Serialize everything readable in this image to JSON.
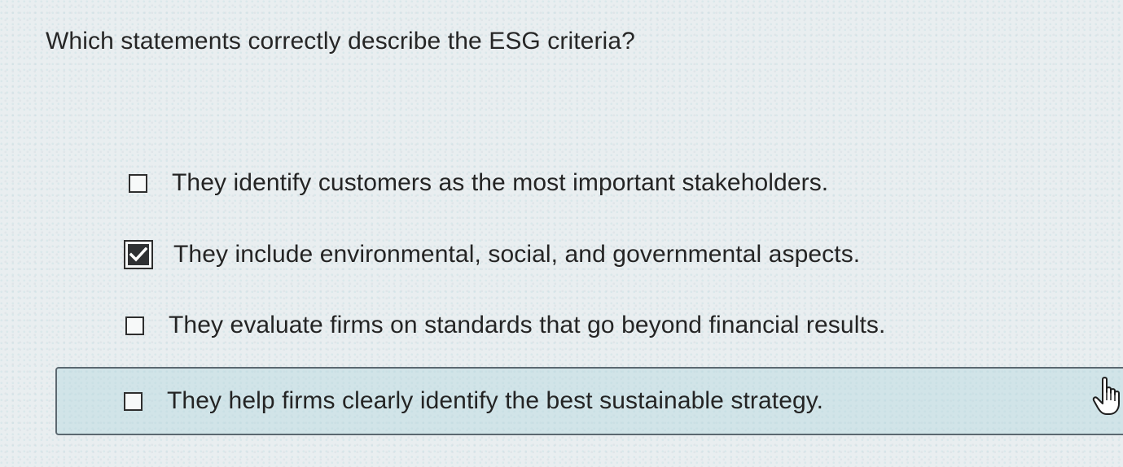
{
  "question": {
    "text": "Which statements correctly describe the ESG criteria?"
  },
  "options": [
    {
      "label": "They identify customers as the most important stakeholders.",
      "checked": false
    },
    {
      "label": "They include environmental, social, and governmental aspects.",
      "checked": true
    },
    {
      "label": "They evaluate firms on standards that go beyond financial results.",
      "checked": false
    },
    {
      "label": "They help firms clearly identify the best sustainable strategy.",
      "checked": false,
      "hovered": true
    }
  ],
  "cursor": {
    "icon": "hand-pointer-icon"
  },
  "colors": {
    "background": "#e9eef0",
    "hover_background": "#b4d7de",
    "text": "#242424",
    "checkbox_border": "#2e2e2e"
  }
}
